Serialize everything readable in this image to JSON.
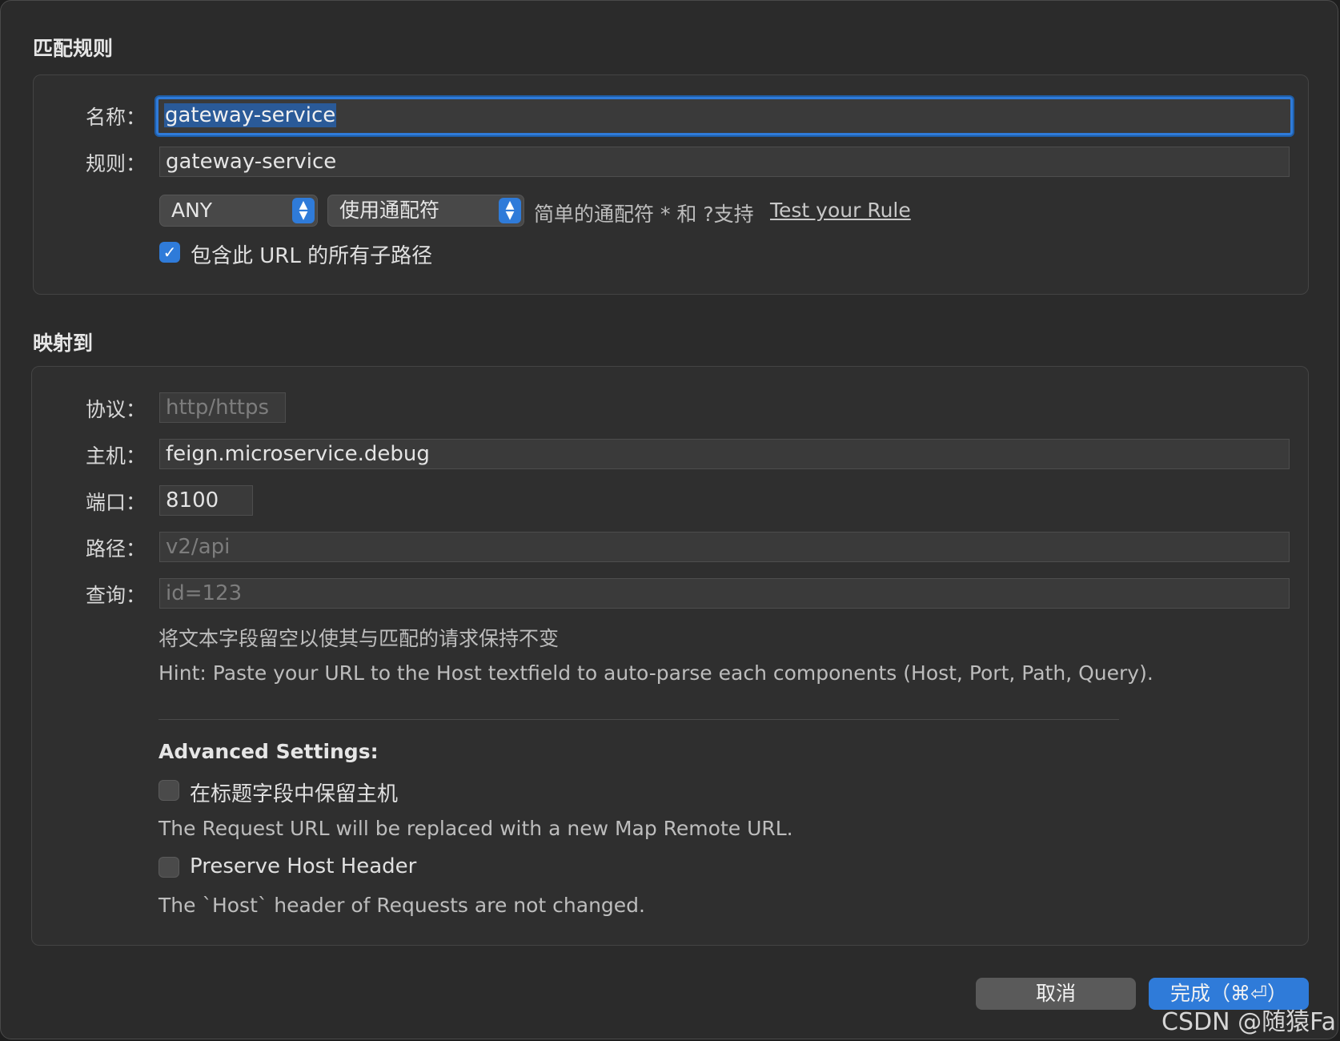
{
  "match_section": {
    "title": "匹配规则",
    "name_label": "名称：",
    "name_value": "gateway-service",
    "rule_label": "规则：",
    "rule_value": "gateway-service",
    "method_select": "ANY",
    "mode_select": "使用通配符",
    "wildcard_hint": "简单的通配符 * 和 ?支持",
    "test_rule_link": "Test your Rule",
    "include_subpaths_label": "包含此 URL 的所有子路径",
    "include_subpaths_checked": true
  },
  "map_section": {
    "title": "映射到",
    "protocol_label": "协议：",
    "protocol_placeholder": "http/https",
    "host_label": "主机：",
    "host_value": "feign.microservice.debug",
    "port_label": "端口：",
    "port_value": "8100",
    "path_label": "路径：",
    "path_placeholder": "v2/api",
    "query_label": "查询：",
    "query_placeholder": "id=123",
    "keep_blank_hint": "将文本字段留空以使其与匹配的请求保持不变",
    "paste_hint": "Hint: Paste your URL to the Host textfield to auto-parse each components (Host, Port, Path, Query).",
    "advanced_title": "Advanced Settings:",
    "keep_host_title_label": "在标题字段中保留主机",
    "keep_host_title_checked": false,
    "keep_host_title_desc": "The Request URL will be replaced with a new Map Remote URL.",
    "preserve_host_label": "Preserve Host Header",
    "preserve_host_checked": false,
    "preserve_host_desc": "The `Host` header of Requests are not changed."
  },
  "footer": {
    "cancel_label": "取消",
    "done_label": "完成（⌘⏎）",
    "watermark": "CSDN @随猿Fa"
  },
  "colors": {
    "accent": "#2f7bd9",
    "background": "#2b2b2b"
  }
}
